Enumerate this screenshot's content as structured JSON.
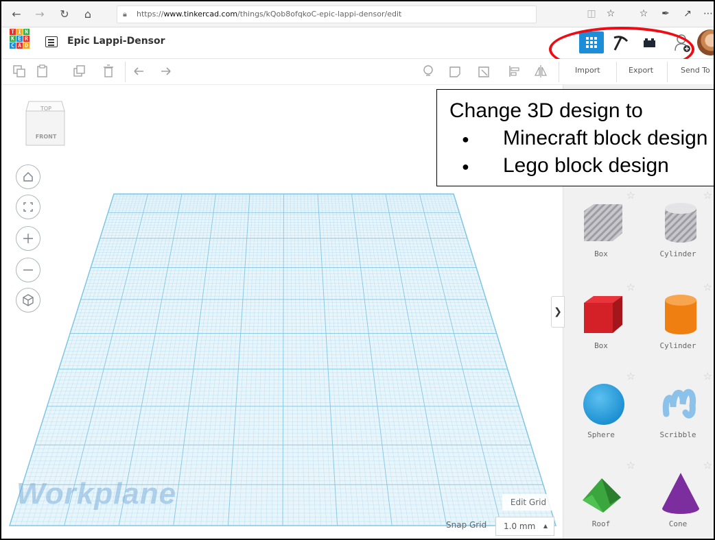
{
  "browser": {
    "url_prefix": "https://",
    "url_domain": "www.tinkercad.com",
    "url_path": "/things/kQob8ofqkoC-epic-lappi-densor/edit"
  },
  "app": {
    "logo_letters": [
      "T",
      "I",
      "N",
      "K",
      "E",
      "R",
      "C",
      "A",
      "D"
    ],
    "design_title": "Epic Lappi-Densor"
  },
  "toolbar": {
    "import_label": "Import",
    "export_label": "Export",
    "send_to_label": "Send To"
  },
  "viewcube": {
    "top_label": "TOP",
    "front_label": "FRONT"
  },
  "workplane": {
    "label": "Workplane",
    "edit_grid_label": "Edit Grid",
    "snap_grid_label": "Snap Grid",
    "snap_grid_value": "1.0 mm"
  },
  "shapes": [
    {
      "label": "Box",
      "icon": "box-hole-icon",
      "color": "#c8c8cc"
    },
    {
      "label": "Cylinder",
      "icon": "cylinder-hole-icon",
      "color": "#c8c8cc"
    },
    {
      "label": "Box",
      "icon": "box-icon",
      "color": "#d42027"
    },
    {
      "label": "Cylinder",
      "icon": "cylinder-icon",
      "color": "#f07f11"
    },
    {
      "label": "Sphere",
      "icon": "sphere-icon",
      "color": "#1b8fd1"
    },
    {
      "label": "Scribble",
      "icon": "scribble-icon",
      "color": "#8cc1e9"
    },
    {
      "label": "Roof",
      "icon": "roof-icon",
      "color": "#3aa63d"
    },
    {
      "label": "Cone",
      "icon": "cone-icon",
      "color": "#7d2e9e"
    }
  ],
  "callout": {
    "title": "Change 3D design to",
    "bullets": [
      "Minecraft block design",
      "Lego block design"
    ]
  },
  "colors": {
    "accent": "#1c8ed8",
    "highlight_circle": "#ef0b14",
    "grid_line": "#7fc6e6"
  }
}
